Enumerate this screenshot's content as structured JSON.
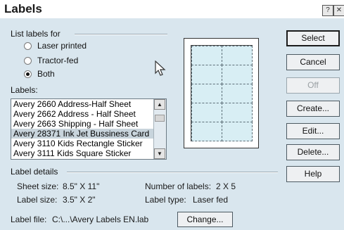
{
  "window": {
    "title": "Labels",
    "help_glyph": "?",
    "close_glyph": "✕"
  },
  "list_labels_for": {
    "heading": "List labels for",
    "options": [
      {
        "label": "Laser printed",
        "selected": false
      },
      {
        "label": "Tractor-fed",
        "selected": false
      },
      {
        "label": "Both",
        "selected": true
      }
    ]
  },
  "labels_list": {
    "heading": "Labels:",
    "items": [
      "Avery 2660 Address-Half Sheet",
      "Avery 2662 Address - Half Sheet",
      "Avery 2663 Shipping - Half Sheet",
      "Avery 28371 Ink Jet Bussiness Card",
      "Avery 3110 Kids Rectangle Sticker",
      "Avery 3111 Kids Square Sticker"
    ],
    "selected_index": 3
  },
  "buttons": {
    "select": "Select",
    "cancel": "Cancel",
    "off": "Off",
    "create": "Create...",
    "edit": "Edit...",
    "delete": "Delete...",
    "help": "Help",
    "change": "Change..."
  },
  "label_details": {
    "heading": "Label details",
    "sheet_size_label": "Sheet size:",
    "sheet_size_value": "8.5\" X 11\"",
    "label_size_label": "Label size:",
    "label_size_value": "3.5\" X 2\"",
    "num_labels_label": "Number of labels:",
    "num_labels_value": "2 X 5",
    "label_type_label": "Label type:",
    "label_type_value": "Laser fed"
  },
  "label_file": {
    "label": "Label file:",
    "path": "C:\\...\\Avery Labels EN.lab"
  },
  "preview": {
    "columns": 2,
    "rows": 5
  }
}
